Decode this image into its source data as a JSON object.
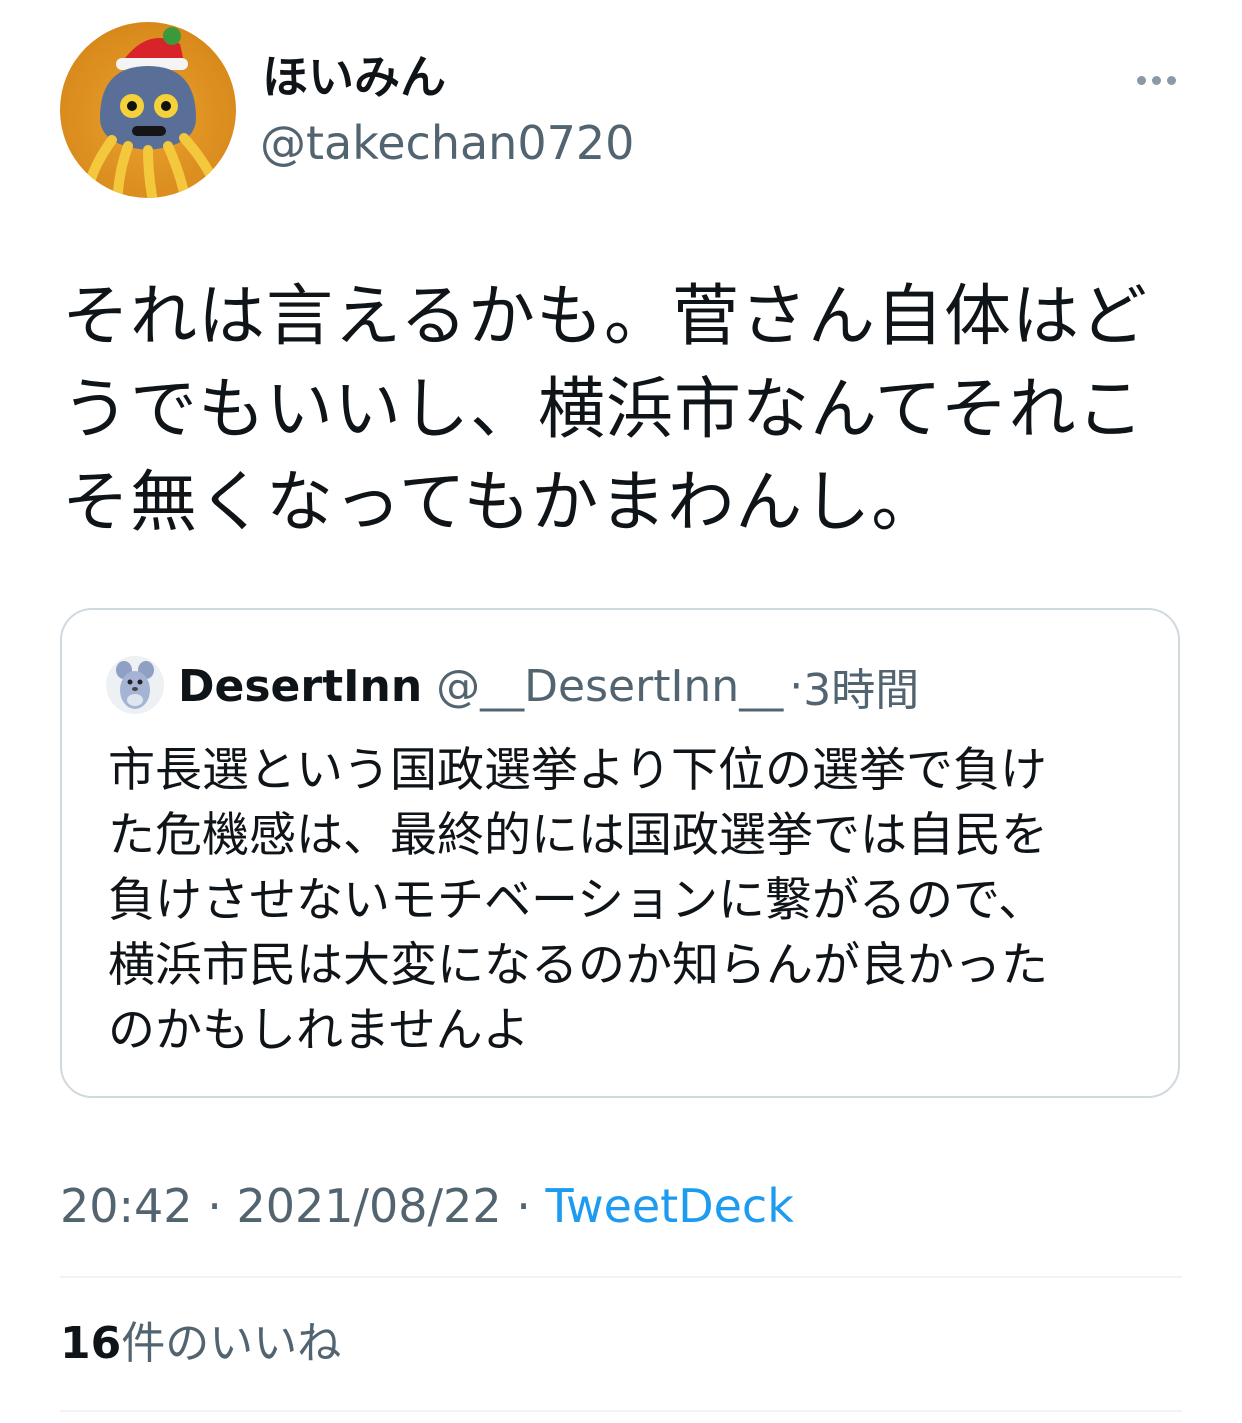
{
  "author": {
    "display_name": "ほいみん",
    "handle": "@takechan0720",
    "avatar_icon": "hoimi-slime-avatar-icon"
  },
  "tweet": {
    "text_lines": [
      "それは言えるかも。菅さん自体はど",
      "うでもいいし、横浜市なんてそれこ",
      "そ無くなってもかまわんし。"
    ]
  },
  "quote": {
    "display_name": "DesertInn",
    "handle": "@__DesertInn__",
    "separator": "·",
    "time": "3時間",
    "avatar_icon": "mouse-character-avatar-icon",
    "text_lines": [
      "市長選という国政選挙より下位の選挙で負け",
      "た危機感は、最終的には国政選挙では自民を",
      "負けさせないモチベーションに繋がるので、",
      "横浜市民は大変になるのか知らんが良かった",
      "のかもしれませんよ"
    ]
  },
  "meta": {
    "time": "20:42",
    "sep1": " · ",
    "date": "2021/08/22",
    "sep2": " · ",
    "source": "TweetDeck"
  },
  "stats": {
    "likes_count": "16",
    "likes_label": "件のいいね"
  },
  "colors": {
    "text": "#0f1419",
    "secondary": "#536471",
    "link": "#1d9bf0",
    "border": "#cfd9de"
  }
}
